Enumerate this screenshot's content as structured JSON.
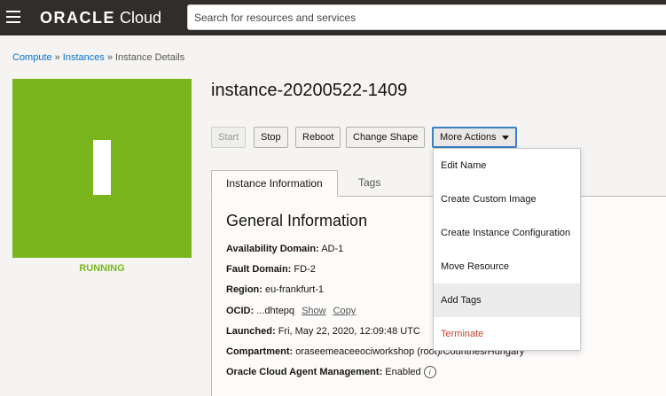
{
  "header": {
    "logo_oracle": "ORACLE",
    "logo_cloud": "Cloud",
    "search_placeholder": "Search for resources and services"
  },
  "breadcrumb": {
    "items": [
      "Compute",
      "Instances",
      "Instance Details"
    ],
    "separator": "»"
  },
  "instance": {
    "letter": "I",
    "state": "RUNNING",
    "name": "instance-20200522-1409",
    "tile_color": "#7ab51d"
  },
  "actions": {
    "start": "Start",
    "stop": "Stop",
    "reboot": "Reboot",
    "change_shape": "Change Shape",
    "more_actions": "More Actions"
  },
  "tabs": [
    {
      "label": "Instance Information",
      "active": true
    },
    {
      "label": "Tags",
      "active": false
    }
  ],
  "general": {
    "title": "General Information",
    "rows": [
      {
        "label": "Availability Domain:",
        "value": "AD-1"
      },
      {
        "label": "Fault Domain:",
        "value": "FD-2"
      },
      {
        "label": "Region:",
        "value": "eu-frankfurt-1"
      },
      {
        "label": "OCID:",
        "value": "...dhtepq",
        "show": "Show",
        "copy": "Copy"
      },
      {
        "label": "Launched:",
        "value": "Fri, May 22, 2020, 12:09:48 UTC"
      },
      {
        "label": "Compartment:",
        "value": "oraseemeaceeociworkshop (root)/Countries/Hungary"
      },
      {
        "label": "Oracle Cloud Agent Management:",
        "value": "Enabled"
      }
    ]
  },
  "menu": {
    "items": [
      "Edit Name",
      "Create Custom Image",
      "Create Instance Configuration",
      "Move Resource",
      "Add Tags",
      "Terminate"
    ],
    "hovered": "Add Tags",
    "danger_color": "#c74634"
  }
}
